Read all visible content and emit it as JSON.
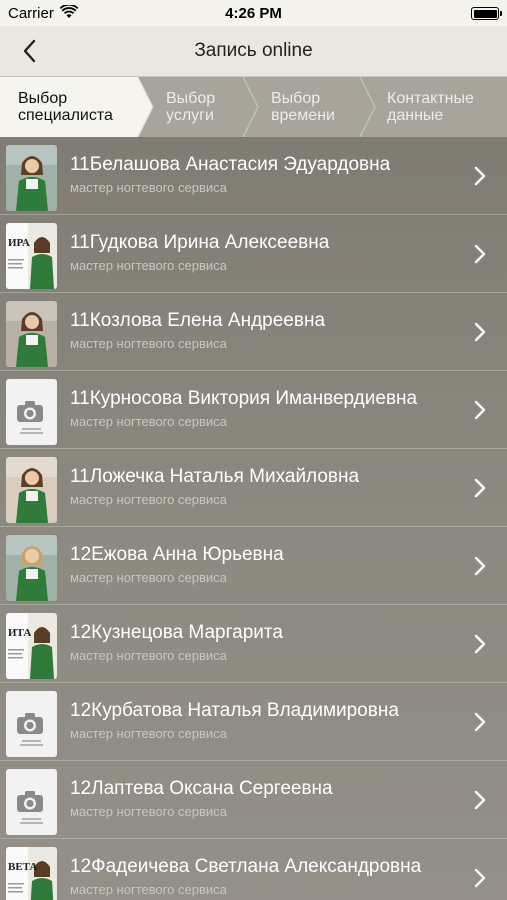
{
  "status": {
    "carrier": "Carrier",
    "time": "4:26 PM"
  },
  "nav": {
    "title": "Запись online"
  },
  "steps": [
    {
      "line1": "Выбор",
      "line2": "специалиста"
    },
    {
      "line1": "Выбор",
      "line2": "услуги"
    },
    {
      "line1": "Выбор",
      "line2": "времени"
    },
    {
      "line1": "Контактные",
      "line2": "данные"
    }
  ],
  "specialists": [
    {
      "name": "11Белашова Анастасия Эдуардовна",
      "role": "мастер ногтевого сервиса",
      "photo": "photo"
    },
    {
      "name": "11Гудкова Ирина Алексеевна",
      "role": "мастер ногтевого сервиса",
      "photo": "card",
      "card_text": "ИРА"
    },
    {
      "name": "11Козлова Елена Андреевна",
      "role": "мастер ногтевого сервиса",
      "photo": "photo"
    },
    {
      "name": "11Курносова Виктория Иманвердиевна",
      "role": "мастер ногтевого сервиса",
      "photo": "placeholder"
    },
    {
      "name": "11Ложечка Наталья Михайловна",
      "role": "мастер ногтевого сервиса",
      "photo": "photo"
    },
    {
      "name": "12Ежова Анна Юрьевна",
      "role": "мастер ногтевого сервиса",
      "photo": "photo"
    },
    {
      "name": "12Кузнецова Маргарита",
      "role": "мастер ногтевого сервиса",
      "photo": "card",
      "card_text": "ИТА"
    },
    {
      "name": "12Курбатова Наталья Владимировна",
      "role": "мастер ногтевого сервиса",
      "photo": "placeholder"
    },
    {
      "name": "12Лаптева Оксана Сергеевна",
      "role": "мастер ногтевого сервиса",
      "photo": "placeholder"
    },
    {
      "name": "12Фадеичева Светлана Александровна",
      "role": "мастер ногтевого сервиса",
      "photo": "card",
      "card_text": "ВЕТА"
    }
  ]
}
